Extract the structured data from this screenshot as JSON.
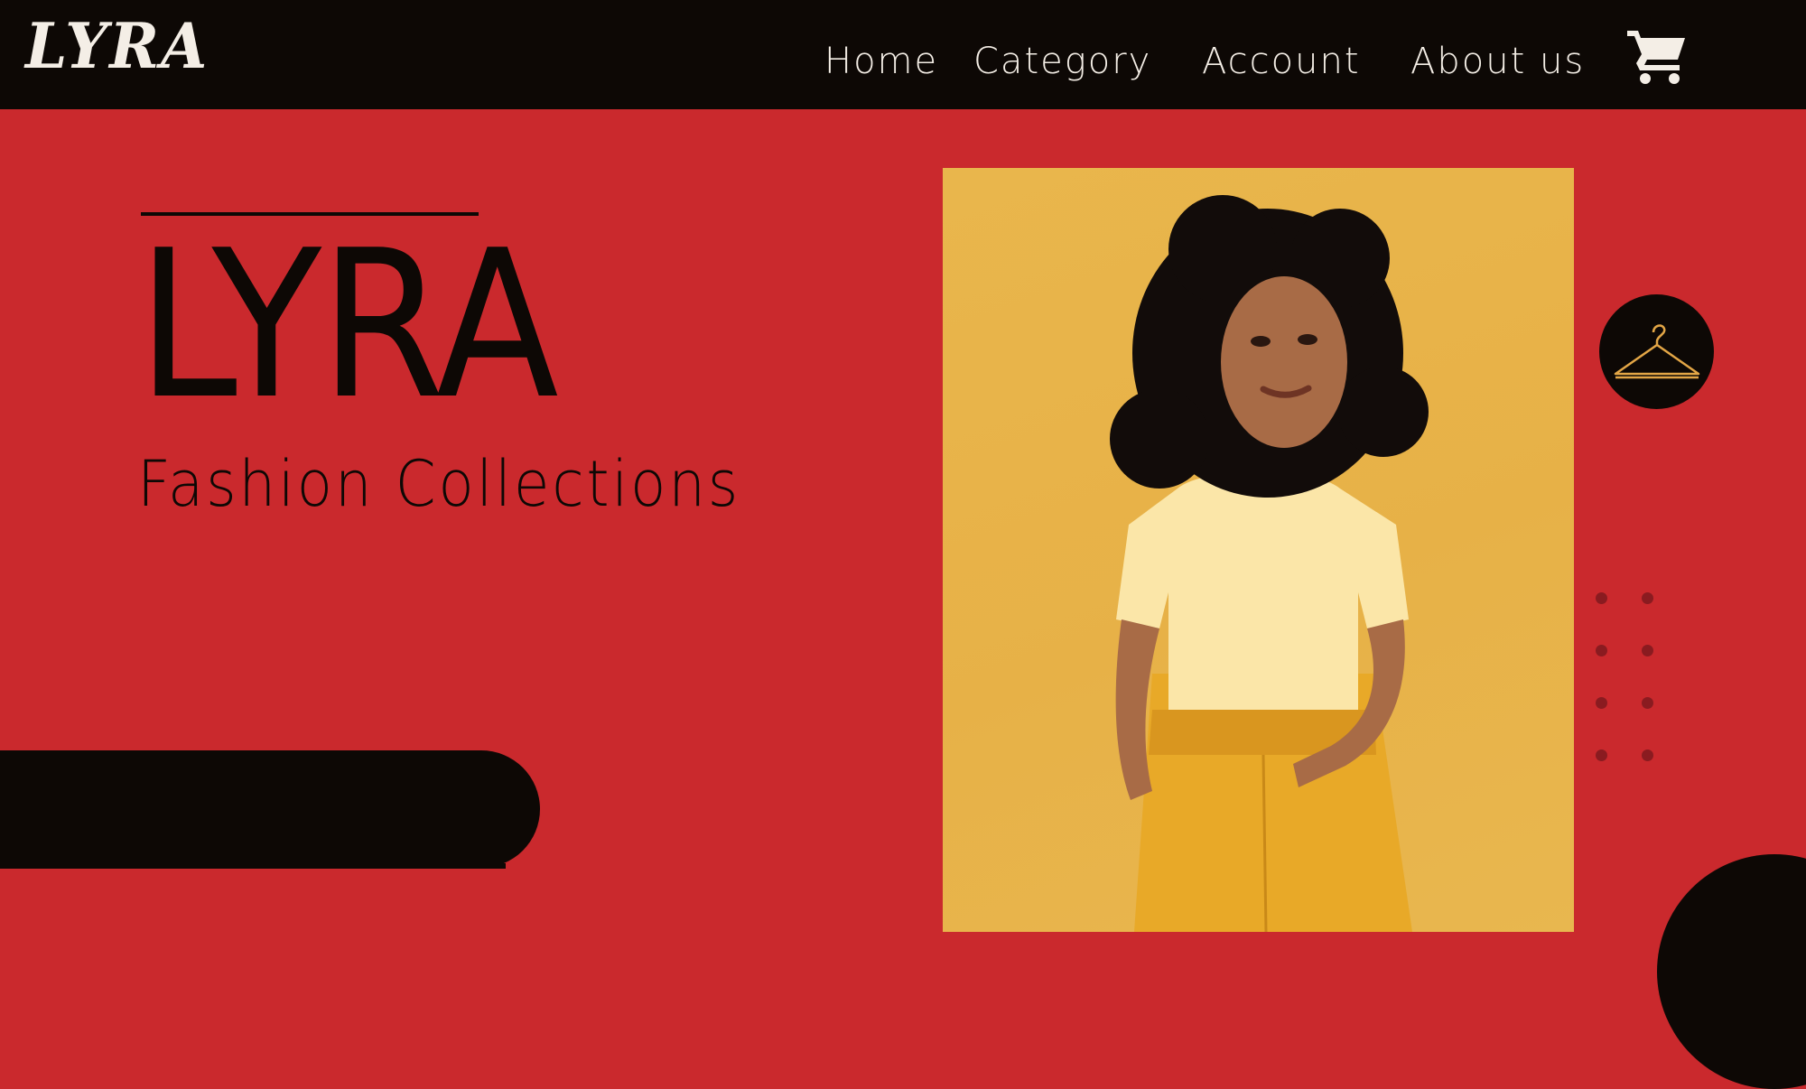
{
  "brand": {
    "logo_text": "LYRA"
  },
  "nav": {
    "items": [
      {
        "label": "Home"
      },
      {
        "label": "Category"
      },
      {
        "label": "Account"
      },
      {
        "label": "About us"
      }
    ],
    "cart_icon": "shopping-cart-icon"
  },
  "hero": {
    "title": "LYRA",
    "subtitle": "Fashion Collections"
  },
  "photo": {
    "subject": "model-photo"
  },
  "icons": {
    "hanger": "hanger-icon"
  },
  "colors": {
    "background": "#CA292D",
    "navbar": "#0D0805",
    "nav_text": "#F4EEE6",
    "photo_background": "#E7B147",
    "hanger_stroke": "#E3A646"
  }
}
